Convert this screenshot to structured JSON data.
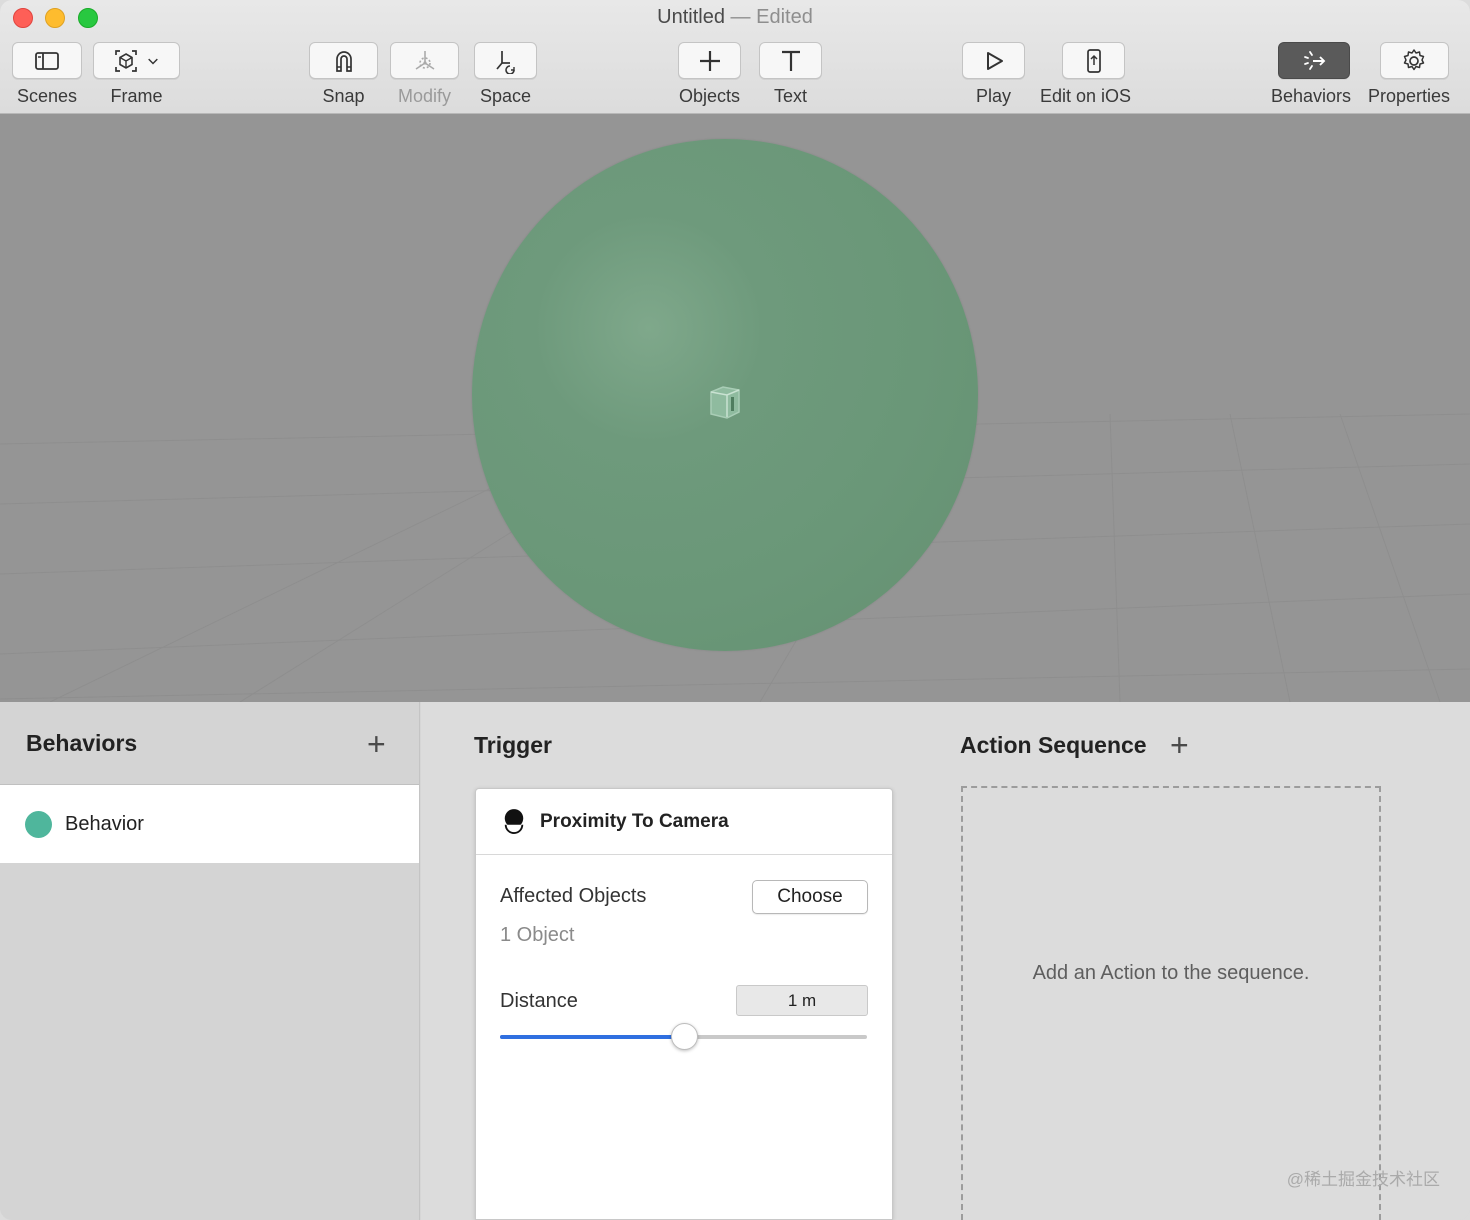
{
  "window": {
    "title": "Untitled",
    "separator": "—",
    "status": "Edited"
  },
  "toolbar": {
    "scenes": "Scenes",
    "frame": "Frame",
    "snap": "Snap",
    "modify": "Modify",
    "space": "Space",
    "objects": "Objects",
    "text": "Text",
    "play": "Play",
    "edit_ios": "Edit on iOS",
    "behaviors": "Behaviors",
    "properties": "Properties"
  },
  "behaviors_panel": {
    "title": "Behaviors",
    "add_glyph": "+",
    "items": [
      {
        "label": "Behavior",
        "color": "#4fb69c"
      }
    ]
  },
  "trigger": {
    "title": "Trigger",
    "card_title": "Proximity To Camera",
    "affected_label": "Affected Objects",
    "affected_value": "1 Object",
    "choose_label": "Choose",
    "distance_label": "Distance",
    "distance_value": "1 m",
    "slider_fraction": 0.5
  },
  "action_sequence": {
    "title": "Action Sequence",
    "add_glyph": "+",
    "empty_text": "Add an Action to the sequence."
  },
  "watermark": "@稀土掘金技术社区",
  "colors": {
    "accent": "#2f6fe0",
    "sphere": "#6a9778",
    "active_toolbar": "#5a5a5a"
  }
}
